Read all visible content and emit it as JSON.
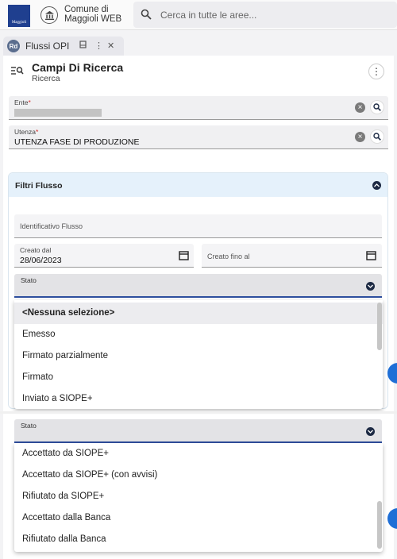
{
  "topbar": {
    "logo_text": "Maggioli",
    "org_line1": "Comune di",
    "org_line2": "Maggioli WEB",
    "search_placeholder": "Cerca in tutte le aree..."
  },
  "tab": {
    "badge": "Rd",
    "label": "Flussi OPI"
  },
  "panel": {
    "title": "Campi Di Ricerca",
    "subtitle": "Ricerca"
  },
  "fields": {
    "ente": {
      "label": "Ente",
      "value": ""
    },
    "utenza": {
      "label": "Utenza",
      "value": "UTENZA FASE DI PRODUZIONE"
    }
  },
  "filters": {
    "title": "Filtri Flusso",
    "identificativo_placeholder": "Identificativo Flusso",
    "creato_dal": {
      "label": "Creato dal",
      "value": "28/06/2023"
    },
    "creato_fino_placeholder": "Creato fino al",
    "stato_label": "Stato"
  },
  "dropdown1": {
    "options": [
      "<Nessuna selezione>",
      "Emesso",
      "Firmato parzialmente",
      "Firmato",
      "Inviato a SIOPE+"
    ],
    "scroll_fraction": 0.0
  },
  "dropdown2": {
    "stato_label": "Stato",
    "options": [
      "Accettato da SIOPE+",
      "Accettato da SIOPE+ (con avvisi)",
      "Rifiutato da SIOPE+",
      "Accettato dalla Banca",
      "Rifiutato dalla Banca"
    ],
    "scroll_fraction": 1.0
  },
  "colors": {
    "accent": "#2e4f9e",
    "header_bg": "#e5f1fb",
    "required": "#d32f2f",
    "primary_button": "#1f6fd6"
  },
  "icons": [
    "search-icon",
    "bank-icon",
    "pin-icon",
    "more-vertical-icon",
    "close-icon",
    "filter-search-icon",
    "clear-icon",
    "magnifier-icon",
    "calendar-icon",
    "chevron-down-icon"
  ]
}
